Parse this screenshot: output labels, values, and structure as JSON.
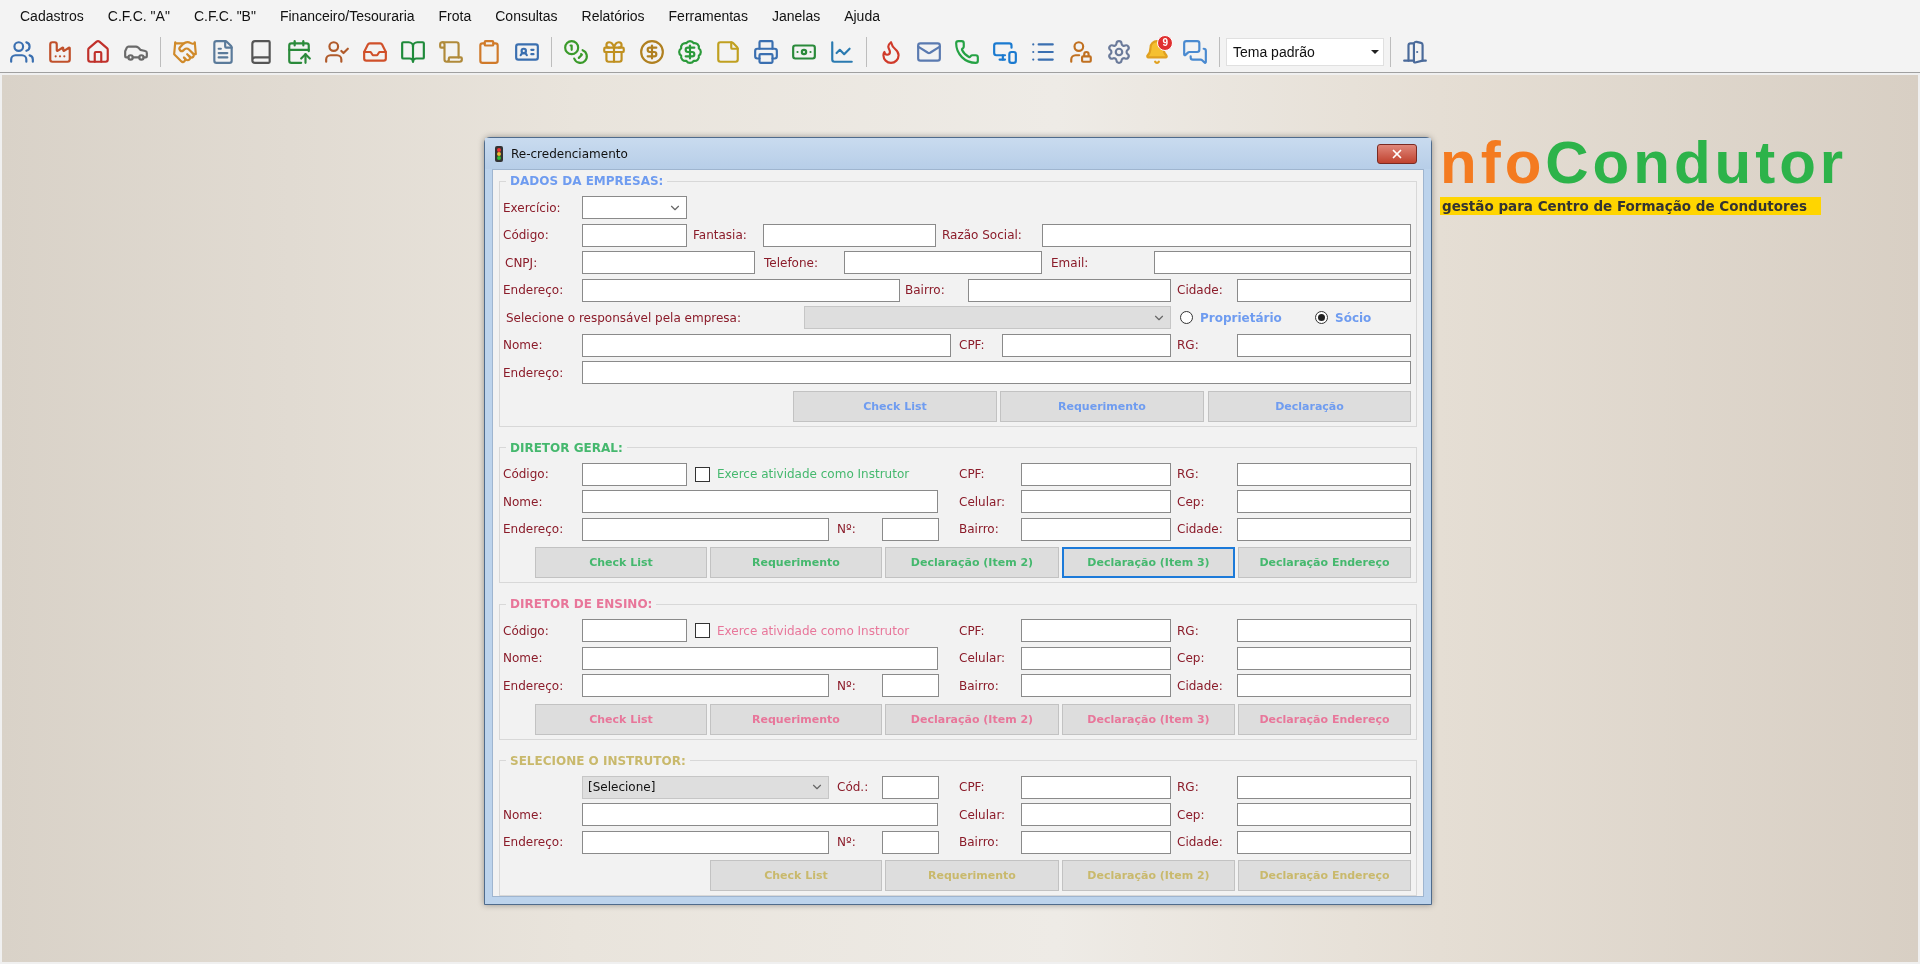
{
  "menu": [
    "Cadastros",
    "C.F.C. \"A\"",
    "C.F.C. \"B\"",
    "Financeiro/Tesouraria",
    "Frota",
    "Consultas",
    "Relatórios",
    "Ferramentas",
    "Janelas",
    "Ajuda"
  ],
  "toolbar": {
    "notification_badge": "9",
    "theme_select": "Tema padrão"
  },
  "logo": {
    "prefix": "nfo",
    "name": "Condutor",
    "tagline": "gestão para Centro de Formação de Condutores"
  },
  "dialog": {
    "title": "Re-credenciamento",
    "sections": [
      {
        "title": "DADOS DA EMPRESAS:",
        "color": "#6f9cf0",
        "rows": [
          [
            {
              "kind": "label",
              "text": "Exercício:"
            },
            {
              "kind": "select",
              "disabled": false
            }
          ],
          [
            {
              "kind": "label",
              "text": "Código:"
            },
            {
              "kind": "field"
            },
            {
              "kind": "label",
              "text": "Fantasia:"
            },
            {
              "kind": "field"
            },
            {
              "kind": "label",
              "text": "Razão Social:"
            },
            {
              "kind": "field"
            }
          ],
          [
            {
              "kind": "label",
              "text": "CNPJ:"
            },
            {
              "kind": "field"
            },
            {
              "kind": "label",
              "text": "Telefone:"
            },
            {
              "kind": "field"
            },
            {
              "kind": "label",
              "text": "Email:"
            },
            {
              "kind": "field"
            }
          ],
          [
            {
              "kind": "label",
              "text": "Endereço:"
            },
            {
              "kind": "field"
            },
            {
              "kind": "label",
              "text": "Bairro:"
            },
            {
              "kind": "field"
            },
            {
              "kind": "label",
              "text": "Cidade:"
            },
            {
              "kind": "field"
            }
          ],
          [
            {
              "kind": "label",
              "text": "Selecione o responsável pela empresa:"
            },
            {
              "kind": "select",
              "disabled": true
            },
            {
              "kind": "radio",
              "label": "Proprietário",
              "selected": false
            },
            {
              "kind": "radio",
              "label": "Sócio",
              "selected": true
            }
          ],
          [
            {
              "kind": "label",
              "text": "Nome:"
            },
            {
              "kind": "field"
            },
            {
              "kind": "label",
              "text": "CPF:"
            },
            {
              "kind": "field"
            },
            {
              "kind": "label",
              "text": "RG:"
            },
            {
              "kind": "field"
            }
          ],
          [
            {
              "kind": "label",
              "text": "Endereço:"
            },
            {
              "kind": "field"
            }
          ]
        ],
        "buttons": [
          {
            "label": "Check List",
            "focused": false
          },
          {
            "label": "Requerimento",
            "focused": false
          },
          {
            "label": "Declaração",
            "focused": false
          }
        ]
      },
      {
        "title": "DIRETOR GERAL:",
        "color": "#45b86e",
        "rows": [
          [
            {
              "kind": "label",
              "text": "Código:"
            },
            {
              "kind": "field"
            },
            {
              "kind": "checkbox",
              "label": "Exerce atividade como Instrutor",
              "checked": false
            },
            "",
            {
              "kind": "label",
              "text": "CPF:"
            },
            {
              "kind": "field"
            },
            {
              "kind": "label",
              "text": "RG:"
            },
            {
              "kind": "field"
            }
          ],
          [
            {
              "kind": "label",
              "text": "Nome:"
            },
            {
              "kind": "field"
            },
            "",
            "",
            {
              "kind": "label",
              "text": "Celular:"
            },
            {
              "kind": "field"
            },
            {
              "kind": "label",
              "text": "Cep:"
            },
            {
              "kind": "field"
            }
          ],
          [
            {
              "kind": "label",
              "text": "Endereço:"
            },
            {
              "kind": "field"
            },
            {
              "kind": "label",
              "text": "Nº:"
            },
            {
              "kind": "field"
            },
            {
              "kind": "label",
              "text": "Bairro:"
            },
            {
              "kind": "field"
            },
            {
              "kind": "label",
              "text": "Cidade:"
            },
            {
              "kind": "field"
            }
          ]
        ],
        "buttons": [
          {
            "label": "Check List",
            "focused": false
          },
          {
            "label": "Requerimento",
            "focused": false
          },
          {
            "label": "Declaração (Item 2)",
            "focused": false
          },
          {
            "label": "Declaração (Item 3)",
            "focused": true
          },
          {
            "label": "Declaração Endereço",
            "focused": false
          }
        ]
      },
      {
        "title": "DIRETOR DE ENSINO:",
        "color": "#e8769a",
        "rows": [
          [
            {
              "kind": "label",
              "text": "Código:"
            },
            {
              "kind": "field"
            },
            {
              "kind": "checkbox",
              "label": "Exerce atividade como Instrutor",
              "checked": false
            },
            "",
            {
              "kind": "label",
              "text": "CPF:"
            },
            {
              "kind": "field"
            },
            {
              "kind": "label",
              "text": "RG:"
            },
            {
              "kind": "field"
            }
          ],
          [
            {
              "kind": "label",
              "text": "Nome:"
            },
            {
              "kind": "field"
            },
            "",
            "",
            {
              "kind": "label",
              "text": "Celular:"
            },
            {
              "kind": "field"
            },
            {
              "kind": "label",
              "text": "Cep:"
            },
            {
              "kind": "field"
            }
          ],
          [
            {
              "kind": "label",
              "text": "Endereço:"
            },
            {
              "kind": "field"
            },
            {
              "kind": "label",
              "text": "Nº:"
            },
            {
              "kind": "field"
            },
            {
              "kind": "label",
              "text": "Bairro:"
            },
            {
              "kind": "field"
            },
            {
              "kind": "label",
              "text": "Cidade:"
            },
            {
              "kind": "field"
            }
          ]
        ],
        "buttons": [
          {
            "label": "Check List",
            "focused": false
          },
          {
            "label": "Requerimento",
            "focused": false
          },
          {
            "label": "Declaração (Item 2)",
            "focused": false
          },
          {
            "label": "Declaração (Item 3)",
            "focused": false
          },
          {
            "label": "Declaração Endereço",
            "focused": false
          }
        ]
      },
      {
        "title": "SELECIONE O INSTRUTOR:",
        "color": "#c9b96c",
        "rows": [
          [
            "",
            {
              "kind": "select",
              "value": "[Selecione]",
              "disabled": true
            },
            {
              "kind": "label",
              "text": "Cód.:"
            },
            {
              "kind": "field"
            },
            {
              "kind": "label",
              "text": "CPF:"
            },
            {
              "kind": "field"
            },
            {
              "kind": "label",
              "text": "RG:"
            },
            {
              "kind": "field"
            }
          ],
          [
            {
              "kind": "label",
              "text": "Nome:"
            },
            {
              "kind": "field"
            },
            "",
            "",
            {
              "kind": "label",
              "text": "Celular:"
            },
            {
              "kind": "field"
            },
            {
              "kind": "label",
              "text": "Cep:"
            },
            {
              "kind": "field"
            }
          ],
          [
            {
              "kind": "label",
              "text": "Endereço:"
            },
            {
              "kind": "field"
            },
            {
              "kind": "label",
              "text": "Nº:"
            },
            {
              "kind": "field"
            },
            {
              "kind": "label",
              "text": "Bairro:"
            },
            {
              "kind": "field"
            },
            {
              "kind": "label",
              "text": "Cidade:"
            },
            {
              "kind": "field"
            }
          ]
        ],
        "buttons": [
          {
            "label": "Check List",
            "focused": false
          },
          {
            "label": "Requerimento",
            "focused": false
          },
          {
            "label": "Declaração (Item 2)",
            "focused": false
          },
          {
            "label": "Declaração Endereço",
            "focused": false
          }
        ]
      }
    ]
  }
}
